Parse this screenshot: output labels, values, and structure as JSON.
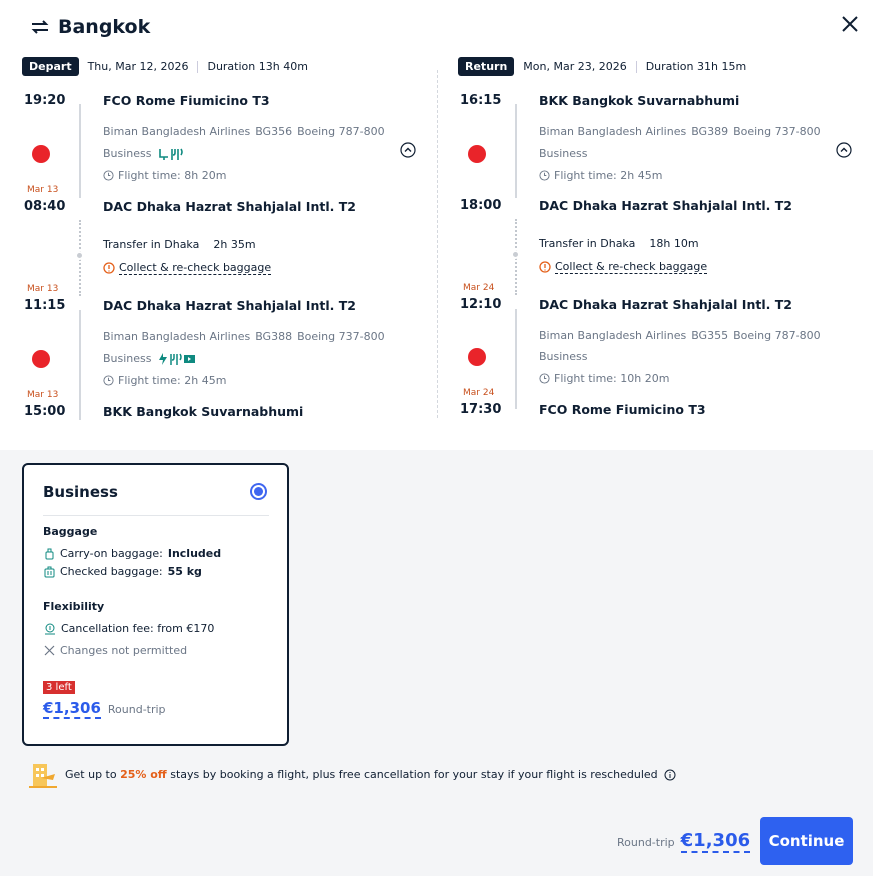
{
  "header": {
    "title": "Bangkok"
  },
  "depart": {
    "tag": "Depart",
    "date": "Thu, Mar 12, 2026",
    "duration": "Duration 13h 40m",
    "leg1": {
      "dep_time": "19:20",
      "dep_airport": "FCO Rome Fiumicino T3",
      "airline": "Biman Bangladesh Airlines",
      "flight": "BG356",
      "aircraft": "Boeing 787-800",
      "cabin": "Business",
      "flight_time": "Flight time: 8h 20m",
      "arr_date": "Mar 13",
      "arr_time": "08:40",
      "arr_airport": "DAC Dhaka Hazrat Shahjalal Intl. T2"
    },
    "transfer": {
      "label": "Transfer in Dhaka",
      "duration": "2h 35m",
      "baggage": "Collect & re-check baggage"
    },
    "leg2": {
      "dep_date": "Mar 13",
      "dep_time": "11:15",
      "dep_airport": "DAC Dhaka Hazrat Shahjalal Intl. T2",
      "airline": "Biman Bangladesh Airlines",
      "flight": "BG388",
      "aircraft": "Boeing 737-800",
      "cabin": "Business",
      "flight_time": "Flight time: 2h 45m",
      "arr_date": "Mar 13",
      "arr_time": "15:00",
      "arr_airport": "BKK Bangkok Suvarnabhumi"
    }
  },
  "return": {
    "tag": "Return",
    "date": "Mon, Mar 23, 2026",
    "duration": "Duration 31h 15m",
    "leg1": {
      "dep_time": "16:15",
      "dep_airport": "BKK Bangkok Suvarnabhumi",
      "airline": "Biman Bangladesh Airlines",
      "flight": "BG389",
      "aircraft": "Boeing 737-800",
      "cabin": "Business",
      "flight_time": "Flight time: 2h 45m",
      "arr_time": "18:00",
      "arr_airport": "DAC Dhaka Hazrat Shahjalal Intl. T2"
    },
    "transfer": {
      "label": "Transfer in Dhaka",
      "duration": "18h 10m",
      "baggage": "Collect & re-check baggage"
    },
    "leg2": {
      "dep_date": "Mar 24",
      "dep_time": "12:10",
      "dep_airport": "DAC Dhaka Hazrat Shahjalal Intl. T2",
      "airline": "Biman Bangladesh Airlines",
      "flight": "BG355",
      "aircraft": "Boeing 787-800",
      "cabin": "Business",
      "flight_time": "Flight time: 10h 20m",
      "arr_date": "Mar 24",
      "arr_time": "17:30",
      "arr_airport": "FCO Rome Fiumicino T3"
    }
  },
  "fare": {
    "name": "Business",
    "baggage_title": "Baggage",
    "carry_on_label": "Carry-on baggage:",
    "carry_on_value": "Included",
    "checked_label": "Checked baggage:",
    "checked_value": "55 kg",
    "flex_title": "Flexibility",
    "cancellation": "Cancellation fee: from €170",
    "changes": "Changes not permitted",
    "seats_left": "3 left",
    "price": "€1,306",
    "price_type": "Round-trip"
  },
  "promo": {
    "prefix": "Get up to ",
    "highlight": "25% off",
    "suffix": " stays by booking a flight, plus free cancellation for your stay if your flight is rescheduled"
  },
  "footer": {
    "label": "Round-trip",
    "price": "€1,306",
    "button": "Continue"
  },
  "colors": {
    "accent": "#2e61f0",
    "airline": "#e9242a",
    "warning": "#e4601a",
    "dark": "#0f1e32"
  }
}
